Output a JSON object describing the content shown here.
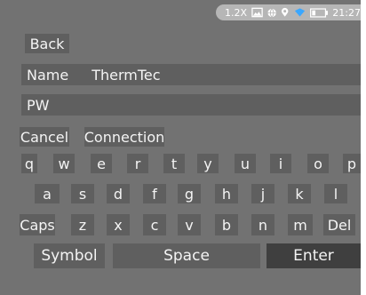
{
  "status": {
    "zoom": "1.2X",
    "time": "21:27",
    "icons": [
      "image-icon",
      "globe-icon",
      "location-icon",
      "wifi-icon",
      "battery-icon"
    ]
  },
  "top": {
    "back_label": "Back"
  },
  "form": {
    "name_label": "Name",
    "name_value": "ThermTec",
    "pw_label": "PW",
    "cancel_label": "Cancel",
    "connection_label": "Connection"
  },
  "keyboard": {
    "row1": [
      "q",
      "w",
      "e",
      "r",
      "t",
      "y",
      "u",
      "i",
      "o",
      "p"
    ],
    "row2": [
      "a",
      "s",
      "d",
      "f",
      "g",
      "h",
      "j",
      "k",
      "l"
    ],
    "row3": [
      "Caps",
      "z",
      "x",
      "c",
      "v",
      "b",
      "n",
      "m",
      "Del"
    ],
    "symbol_label": "Symbol",
    "space_label": "Space",
    "enter_label": "Enter"
  },
  "colors": {
    "background": "#727272",
    "key": "#5f5f5f",
    "enter": "#3f3f3f",
    "accent_wifi": "#3aa7ff"
  }
}
